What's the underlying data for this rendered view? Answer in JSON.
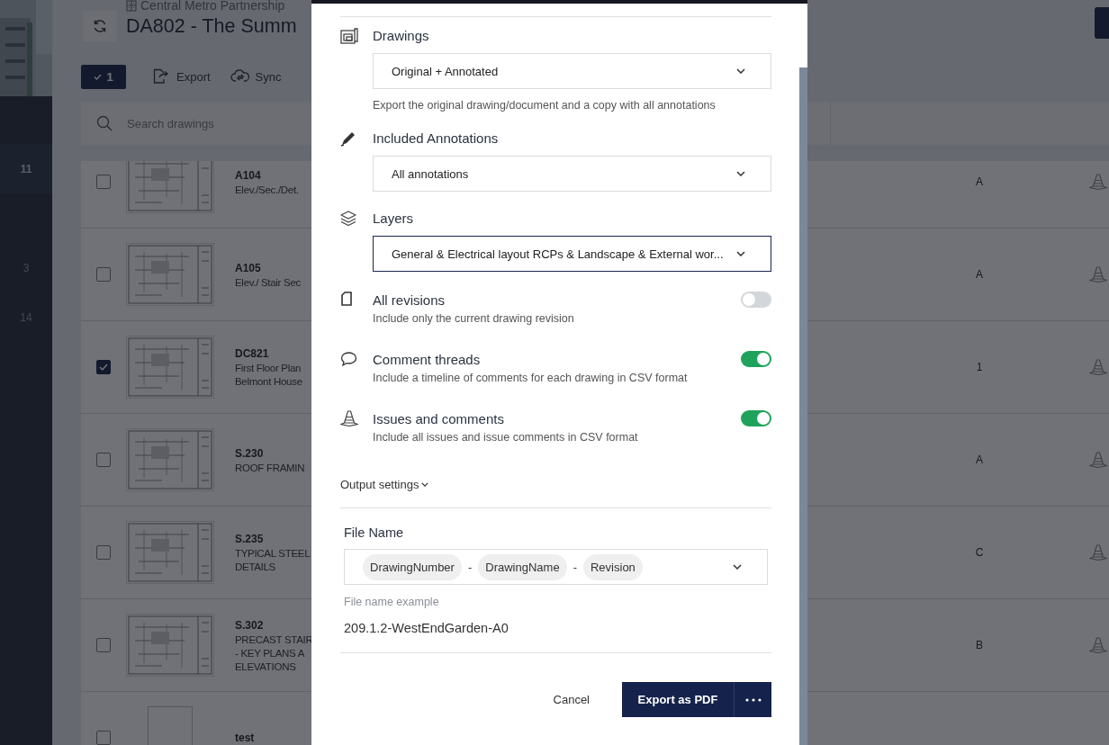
{
  "sidebar": {
    "counts": [
      {
        "label": "11",
        "selected": true
      },
      {
        "label": "3",
        "selected": false
      },
      {
        "label": "14",
        "selected": false
      }
    ]
  },
  "header": {
    "organization": "Central Metro Partnership",
    "title": "DA802 - The Summ"
  },
  "toolbar": {
    "selection_count": "1",
    "actions": [
      {
        "kind": "export",
        "label": "Export"
      },
      {
        "kind": "sync",
        "label": "Sync"
      }
    ]
  },
  "search": {
    "placeholder": "Search drawings"
  },
  "drawings": [
    {
      "number": "A104",
      "name_lines": [
        "Elev./Sec./Det."
      ],
      "revision": "A",
      "checked": false,
      "kind": "sheet"
    },
    {
      "number": "A105",
      "name_lines": [
        "Elev./ Stair Sec"
      ],
      "revision": "A",
      "checked": false,
      "kind": "sheet"
    },
    {
      "number": "DC821",
      "name_lines": [
        "First Floor Plan",
        "Belmont House"
      ],
      "revision": "1",
      "checked": true,
      "kind": "sheet"
    },
    {
      "number": "S.230",
      "name_lines": [
        "ROOF FRAMIN"
      ],
      "revision": "A",
      "checked": false,
      "kind": "sheet"
    },
    {
      "number": "S.235",
      "name_lines": [
        "TYPICAL STEEL",
        "DETAILS"
      ],
      "revision": "C",
      "checked": false,
      "kind": "sheet"
    },
    {
      "number": "S.302",
      "name_lines": [
        "PRECAST STAIR",
        "- KEY PLANS A",
        "ELEVATIONS"
      ],
      "revision": "B",
      "checked": false,
      "kind": "sheet"
    },
    {
      "number": "test",
      "checked": false,
      "kind": "blank"
    }
  ],
  "export_dialog": {
    "selects": [
      {
        "kind": "drawings",
        "title": "Drawings",
        "value": "Original + Annotated",
        "help": "Export the original drawing/document and a copy with all annotations",
        "focused": false
      },
      {
        "kind": "annotations",
        "title": "Included Annotations",
        "value": "All annotations",
        "focused": false
      },
      {
        "kind": "layers",
        "title": "Layers",
        "value": "General & Electrical layout RCPs & Landscape & External wor...",
        "focused": true
      }
    ],
    "toggles": [
      {
        "kind": "revisions",
        "title": "All revisions",
        "description": "Include only the current drawing revision",
        "on": false
      },
      {
        "kind": "comments",
        "title": "Comment threads",
        "description": "Include a timeline of comments for each drawing in CSV format",
        "on": true
      },
      {
        "kind": "issues",
        "title": "Issues and comments",
        "description": "Include all issues and issue comments in CSV format",
        "on": true
      }
    ],
    "output_settings": {
      "label": "Output settings",
      "expanded": true
    },
    "file_name": {
      "label": "File Name",
      "parts": [
        {
          "kind": "token",
          "label": "DrawingNumber"
        },
        {
          "kind": "separator",
          "label": "-"
        },
        {
          "kind": "token",
          "label": "DrawingName"
        },
        {
          "kind": "separator",
          "label": "-"
        },
        {
          "kind": "token",
          "label": "Revision"
        }
      ],
      "example_label": "File name example",
      "example": "209.1.2-WestEndGarden-A0"
    },
    "buttons": {
      "cancel": "Cancel",
      "primary": "Export as PDF"
    }
  }
}
